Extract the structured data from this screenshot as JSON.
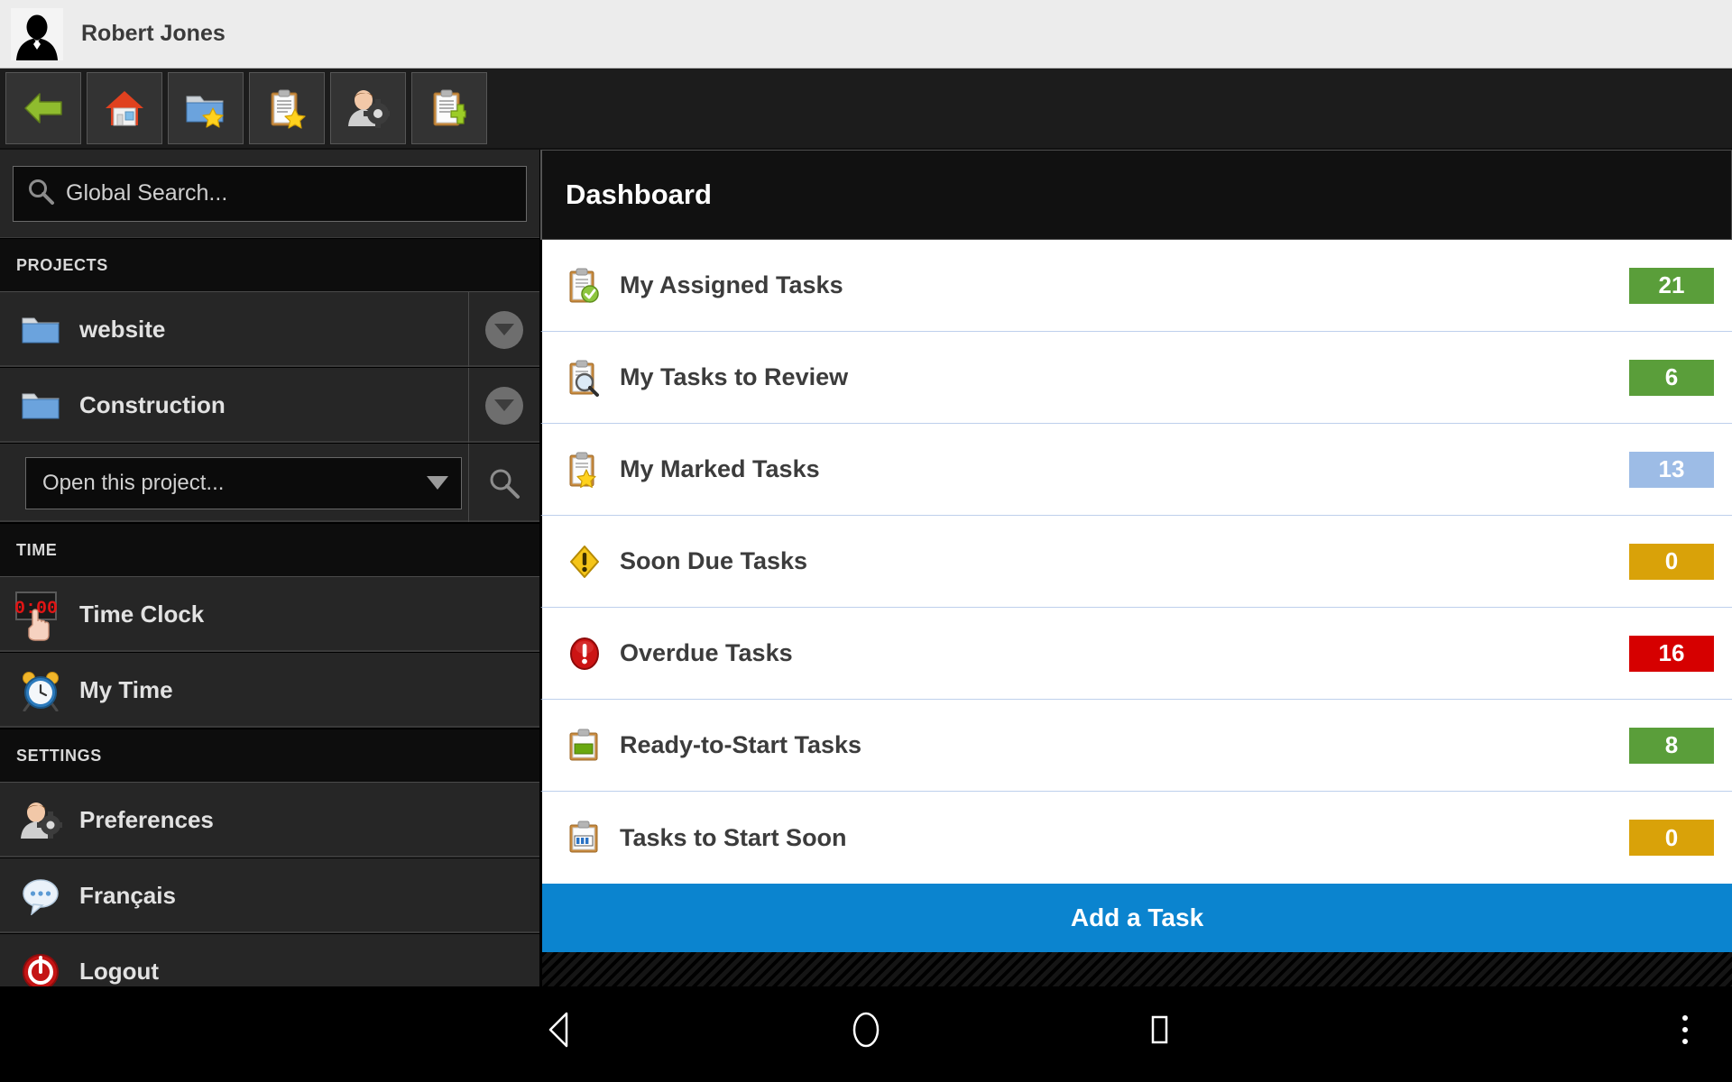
{
  "user": {
    "name": "Robert Jones",
    "avatar_icon": "user-silhouette-icon"
  },
  "toolbar": {
    "buttons": [
      {
        "name": "back-button",
        "icon": "green-left-arrow-icon"
      },
      {
        "name": "home-button",
        "icon": "house-icon"
      },
      {
        "name": "favorite-projects-button",
        "icon": "folder-star-icon"
      },
      {
        "name": "marked-tasks-button",
        "icon": "clipboard-star-icon"
      },
      {
        "name": "user-preferences-button",
        "icon": "user-gear-icon"
      },
      {
        "name": "add-task-button",
        "icon": "clipboard-plus-icon"
      }
    ]
  },
  "sidebar": {
    "search": {
      "placeholder": "Global Search...",
      "icon": "search-icon"
    },
    "sections": [
      {
        "title": "PROJECTS",
        "items": [
          {
            "label": "website",
            "icon": "folder-icon",
            "chevron": "chevron-down-icon"
          },
          {
            "label": "Construction",
            "icon": "folder-icon",
            "chevron": "chevron-down-icon"
          }
        ]
      },
      {
        "title": "TIME",
        "items": [
          {
            "label": "Time Clock",
            "icon": "digital-clock-icon"
          },
          {
            "label": "My Time",
            "icon": "alarm-clock-icon"
          }
        ]
      },
      {
        "title": "SETTINGS",
        "items": [
          {
            "label": "Preferences",
            "icon": "user-gear-icon"
          },
          {
            "label": "Français",
            "icon": "speech-bubble-icon"
          },
          {
            "label": "Logout",
            "icon": "logout-icon"
          }
        ]
      }
    ],
    "open_project": {
      "value": "Open this project...",
      "caret_icon": "caret-down-icon",
      "search_icon": "search-icon"
    },
    "time_clock_value": "0:00"
  },
  "content": {
    "title": "Dashboard",
    "rows": [
      {
        "label": "My Assigned Tasks",
        "count": "21",
        "color": "#5a9e3a",
        "icon": "clipboard-check-icon"
      },
      {
        "label": "My Tasks to Review",
        "count": "6",
        "color": "#5a9e3a",
        "icon": "clipboard-magnifier-icon"
      },
      {
        "label": "My Marked Tasks",
        "count": "13",
        "color": "#9dbce6",
        "icon": "clipboard-star-icon"
      },
      {
        "label": "Soon Due Tasks",
        "count": "0",
        "color": "#d9a209",
        "icon": "yellow-warning-diamond-icon"
      },
      {
        "label": "Overdue Tasks",
        "count": "16",
        "color": "#d60000",
        "icon": "red-alert-circle-icon"
      },
      {
        "label": "Ready-to-Start Tasks",
        "count": "8",
        "color": "#5a9e3a",
        "icon": "clipboard-green-bar-icon"
      },
      {
        "label": "Tasks to Start Soon",
        "count": "0",
        "color": "#d9a209",
        "icon": "clipboard-blue-bars-icon"
      }
    ],
    "add_task_label": "Add a Task"
  },
  "android_nav": {
    "back": "back-triangle-icon",
    "home": "home-circle-icon",
    "recent": "recent-apps-square-icon",
    "menu": "overflow-menu-icon"
  },
  "colors": {
    "accent_blue": "#0b84cf",
    "green": "#5a9e3a",
    "light_blue": "#9dbce6",
    "gold": "#d9a209",
    "red": "#d60000"
  }
}
